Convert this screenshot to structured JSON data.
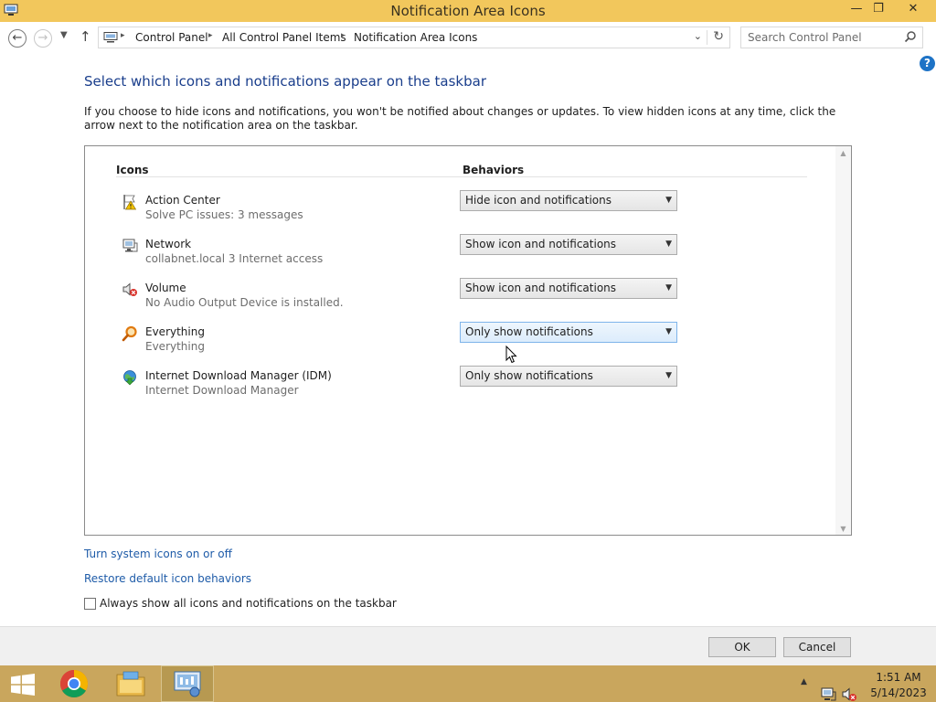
{
  "window": {
    "title": "Notification Area Icons",
    "minimize_glyph": "—",
    "restore_glyph": "❐",
    "close_glyph": "✕"
  },
  "address_bar": {
    "breadcrumbs": [
      "Control Panel",
      "All Control Panel Items",
      "Notification Area Icons"
    ],
    "search_placeholder": "Search Control Panel"
  },
  "help_glyph": "?",
  "page": {
    "heading": "Select which icons and notifications appear on the taskbar",
    "description": "If you choose to hide icons and notifications, you won't be notified about changes or updates. To view hidden icons at any time, click the arrow next to the notification area on the taskbar."
  },
  "table": {
    "col_icons": "Icons",
    "col_behaviors": "Behaviors",
    "rows": [
      {
        "name": "Action Center",
        "sub": "Solve PC issues: 3 messages",
        "behavior": "Hide icon and notifications",
        "icon": "action-center-flag-icon"
      },
      {
        "name": "Network",
        "sub": "collabnet.local  3 Internet access",
        "behavior": "Show icon and notifications",
        "icon": "network-icon"
      },
      {
        "name": "Volume",
        "sub": "No Audio Output Device is installed.",
        "behavior": "Show icon and notifications",
        "icon": "volume-muted-icon"
      },
      {
        "name": "Everything",
        "sub": "Everything",
        "behavior": "Only show notifications",
        "icon": "magnifier-icon"
      },
      {
        "name": "Internet Download Manager (IDM)",
        "sub": "Internet Download Manager",
        "behavior": "Only show notifications",
        "icon": "globe-download-icon"
      }
    ]
  },
  "links": {
    "system_icons": "Turn system icons on or off",
    "restore_defaults": "Restore default icon behaviors"
  },
  "checkbox": {
    "label": "Always show all icons and notifications on the taskbar",
    "checked": false
  },
  "buttons": {
    "ok": "OK",
    "cancel": "Cancel"
  },
  "taskbar": {
    "time": "1:51 AM",
    "date": "5/14/2023",
    "tray_expand_glyph": "▲"
  },
  "colors": {
    "titlebar": "#f2c75c",
    "taskbar": "#c9a65d",
    "link": "#1e5ba8",
    "heading": "#1a3e8c"
  }
}
